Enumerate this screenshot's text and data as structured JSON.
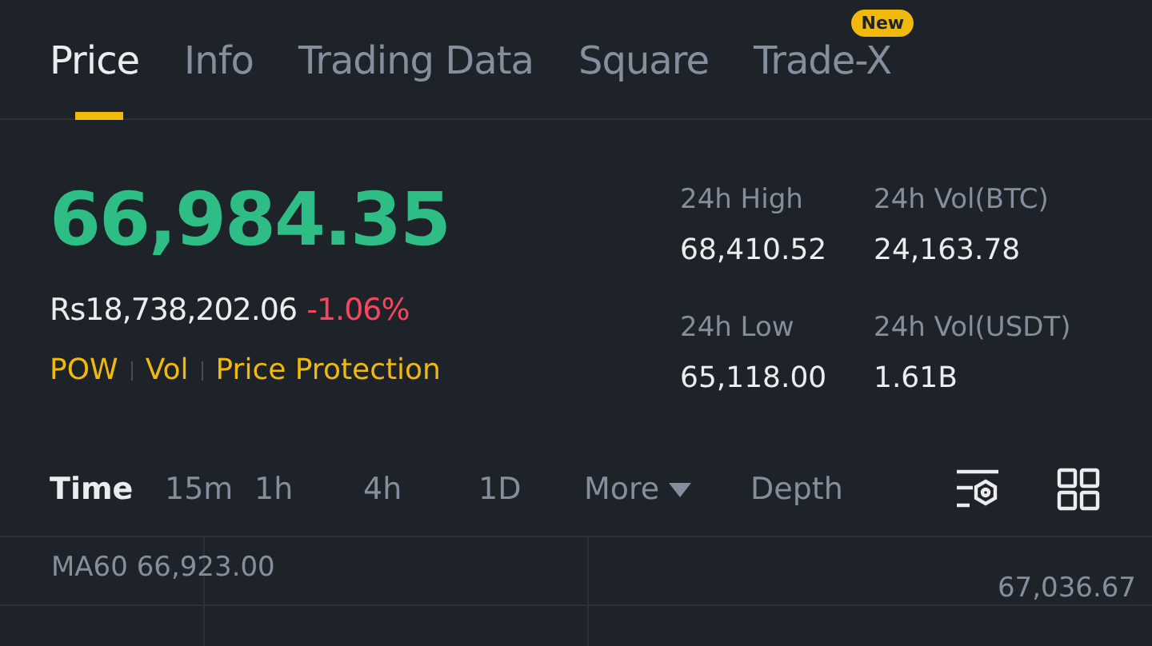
{
  "tabs": [
    {
      "label": "Price",
      "selected": true
    },
    {
      "label": "Info",
      "selected": false
    },
    {
      "label": "Trading Data",
      "selected": false
    },
    {
      "label": "Square",
      "selected": false
    },
    {
      "label": "Trade-X",
      "selected": false,
      "badge": "New"
    }
  ],
  "price": {
    "last": "66,984.35",
    "converted": "Rs18,738,202.06",
    "change": "-1.06%",
    "tags": [
      "POW",
      "Vol",
      "Price Protection"
    ]
  },
  "stats": [
    {
      "label": "24h High",
      "value": "68,410.52"
    },
    {
      "label": "24h Vol(BTC)",
      "value": "24,163.78"
    },
    {
      "label": "24h Low",
      "value": "65,118.00"
    },
    {
      "label": "24h Vol(USDT)",
      "value": "1.61B"
    }
  ],
  "intervals": [
    {
      "label": "Time",
      "kind": "interval",
      "selected": true
    },
    {
      "label": "15m",
      "kind": "interval",
      "selected": false
    },
    {
      "label": "1h",
      "kind": "interval",
      "selected": false
    },
    {
      "label": "4h",
      "kind": "interval",
      "selected": false
    },
    {
      "label": "1D",
      "kind": "interval",
      "selected": false
    },
    {
      "label": "More",
      "kind": "dropdown",
      "selected": false
    },
    {
      "label": "Depth",
      "kind": "interval",
      "selected": false
    }
  ],
  "chart": {
    "indicator": "MA60 66,923.00",
    "price_label": "67,036.67"
  }
}
